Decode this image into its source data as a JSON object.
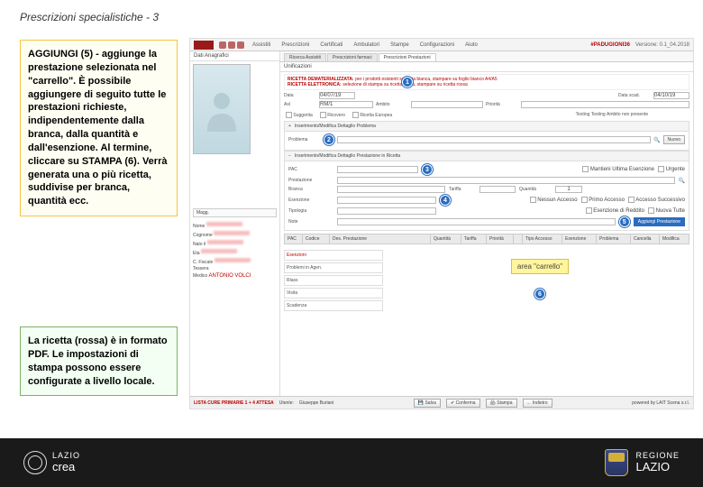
{
  "title": "Prescrizioni specialistiche - 3",
  "box1": "AGGIUNGI (5) -  aggiunge la prestazione selezionata nel \"carrello\". È possibile aggiungere di seguito tutte le prestazioni richieste, indipendentemente dalla branca, dalla quantità e dall'esenzione.\nAl termine, cliccare su STAMPA (6). Verrà generata una o più ricetta, suddivise per branca, quantità ecc.",
  "box2": "La ricetta (rossa) è in formato PDF. Le impostazioni di stampa possono essere configurate a livello locale.",
  "padu": "#PADUGIONI36",
  "version": "Versione: 0.1_04.2018",
  "menus": [
    "Assistiti",
    "Prescrizioni",
    "Certificati",
    "Ambulatori",
    "Stampe",
    "Configurazioni",
    "Aiuto"
  ],
  "tabs": [
    "Ricerca Assistiti",
    "Prescrizioni farmaci",
    "Prescrizioni Prestazioni"
  ],
  "tab_bar_label": "Dati Anagrafici",
  "unify": "Unificazioni",
  "badge": "Magg.",
  "patient": {
    "labels": [
      "Nome",
      "Cognome",
      "Nato il",
      "Eta",
      "C. Fiscale",
      "Tessera",
      "Medico"
    ],
    "doctor": "ANTONIO VOLCI"
  },
  "red1": "RICETTA DEMATERIALIZZATA:",
  "red1b": "per i prodotti esistenti su carta bianca, stampare su foglio bianco A4/A5",
  "red2": "RICETTA ELETTRONICA:",
  "red2b": "selezione di stampa su ricetta rossa, stampare su ricetta rossa",
  "f_data": "Data",
  "f_data_val": "04/07/19",
  "f_data_scad": "Data scad.",
  "f_data_scad_val": "04/10/19",
  "f_asl": "Asl",
  "f_asl_val": "RM/1",
  "f_amb": "Ambito",
  "f_priorita": "Priorità",
  "chk_suggerita": "Suggerita",
  "chk_ricovero": "Ricovero",
  "chk_ricetta_europea": "Ricetta Europea",
  "f_testing": "Testing  Testing",
  "testing_val": "Ambito non presente",
  "panel2": "Inserimento/Modifica Dettaglio Problema",
  "lbl_problema": "Problema",
  "btn_nuovo": "Nuovo",
  "panel3": "Inserimento/Modifica Dettaglio Prestazione in Ricetta",
  "lbl_pac": "PAC",
  "chk_mantieni": "Mantieni Ultima Esenzione",
  "chk_urgente": "Urgente",
  "lbl_prestazione": "Prestazione",
  "lbl_branca": "Branca",
  "lbl_tariffa": "Tariffa",
  "lbl_quantita": "Quantità",
  "qty_val": "1",
  "lbl_esenzione": "Esenzione",
  "chk_nessun_accesso": "Nessun Accesso",
  "chk_primo_accesso": "Primo Accesso",
  "chk_accesso_succ": "Accesso Successivo",
  "lbl_tipologia": "Tipologia",
  "chk_esenzione_reddito": "Esenzione di Reddito",
  "chk_nuova_tutte": "Nuova Tutte",
  "lbl_note": "Note",
  "btn_aggiungi": "Aggiungi Prestazione",
  "table_cols": [
    "PAC",
    "Codice",
    "Des. Prestazione",
    "Quantità",
    "Tariffa",
    "Priorità",
    "",
    "Tipo Accesso",
    "Esenzione",
    "Problema",
    "Cancella",
    "Modifica"
  ],
  "carrello": "area \"carrello\"",
  "status_left": "LISTA CURE PRIMARIE 1 + 4 ATTESA",
  "status_user": "Utente:",
  "status_user_val": "Giuseppe Buriani",
  "btn_salva": "Salva",
  "btn_conferma": "Conferma",
  "btn_stampa": "Stampa",
  "btn_indietro": "Indietro",
  "powered": "powered by LAIT Scena s.r.l.",
  "footer_left_l1": "LAZIO",
  "footer_left_l2": "crea",
  "footer_right_l1": "REGIONE",
  "footer_right_l2": "LAZIO"
}
